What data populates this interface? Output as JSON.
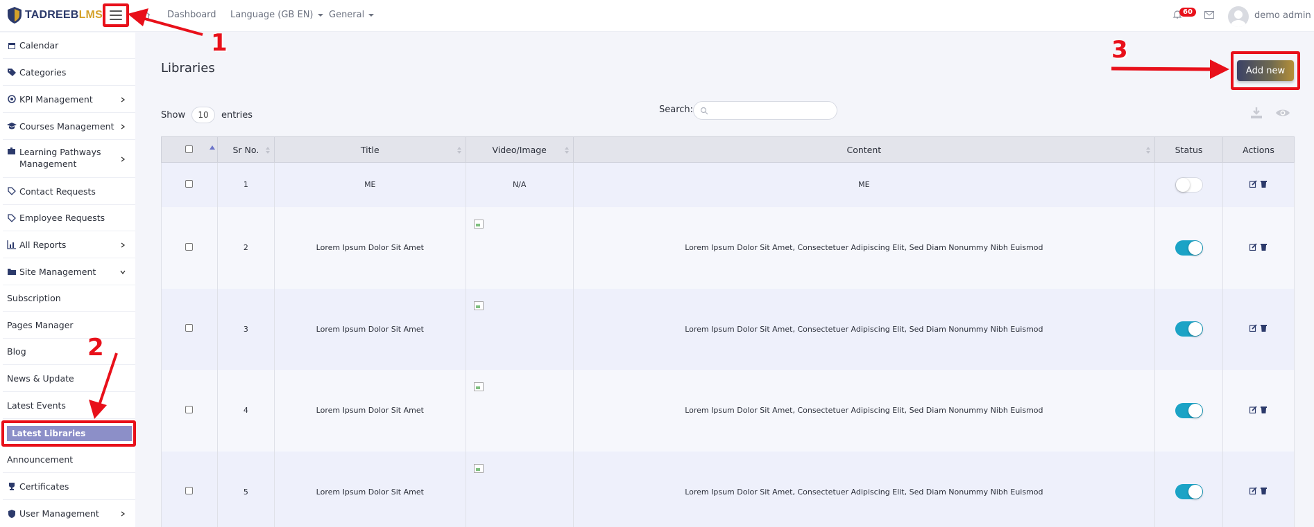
{
  "brand": {
    "name_main": "TADREEB",
    "name_accent": "LMS"
  },
  "topnav": {
    "dashboard": "Dashboard",
    "language": "Language (GB EN)",
    "general": "General",
    "notification_count": "60",
    "username": "demo admin"
  },
  "sidebar": {
    "items": [
      {
        "label": "Calendar",
        "icon": "calendar-icon"
      },
      {
        "label": "Categories",
        "icon": "tags-icon"
      },
      {
        "label": "KPI Management",
        "icon": "target-icon"
      },
      {
        "label": "Courses Management",
        "icon": "graduation-cap-icon"
      },
      {
        "label": "Learning Pathways Management",
        "icon": "puzzle-icon"
      },
      {
        "label": "Contact Requests",
        "icon": "tag-icon"
      },
      {
        "label": "Employee Requests",
        "icon": "tag-icon"
      },
      {
        "label": "All Reports",
        "icon": "chart-icon"
      },
      {
        "label": "Site Management",
        "icon": "folder-icon"
      },
      {
        "label": "Subscription"
      },
      {
        "label": "Pages Manager"
      },
      {
        "label": "Blog"
      },
      {
        "label": "News & Update"
      },
      {
        "label": "Latest Events"
      },
      {
        "label": "Latest Libraries"
      },
      {
        "label": "Announcement"
      },
      {
        "label": "Certificates",
        "icon": "trophy-icon"
      },
      {
        "label": "User Management",
        "icon": "shield-icon"
      }
    ]
  },
  "main": {
    "title": "Libraries",
    "add_new": "Add new",
    "show_label": "Show",
    "entries_value": "10",
    "entries_label": "entries",
    "search_label": "Search:"
  },
  "table": {
    "columns": [
      "Sr No.",
      "Title",
      "Video/Image",
      "Content",
      "Status",
      "Actions"
    ],
    "rows": [
      {
        "sr": "1",
        "title": "ME",
        "media": "N/A",
        "content": "ME",
        "status": "off"
      },
      {
        "sr": "2",
        "title": "Lorem Ipsum Dolor Sit Amet",
        "media": "image",
        "content": "Lorem Ipsum Dolor Sit Amet, Consectetuer Adipiscing Elit, Sed Diam Nonummy Nibh Euismod",
        "status": "on"
      },
      {
        "sr": "3",
        "title": "Lorem Ipsum Dolor Sit Amet",
        "media": "image",
        "content": "Lorem Ipsum Dolor Sit Amet, Consectetuer Adipiscing Elit, Sed Diam Nonummy Nibh Euismod",
        "status": "on"
      },
      {
        "sr": "4",
        "title": "Lorem Ipsum Dolor Sit Amet",
        "media": "image",
        "content": "Lorem Ipsum Dolor Sit Amet, Consectetuer Adipiscing Elit, Sed Diam Nonummy Nibh Euismod",
        "status": "on"
      },
      {
        "sr": "5",
        "title": "Lorem Ipsum Dolor Sit Amet",
        "media": "image",
        "content": "Lorem Ipsum Dolor Sit Amet, Consectetuer Adipiscing Elit, Sed Diam Nonummy Nibh Euismod",
        "status": "on"
      }
    ]
  },
  "annotations": {
    "one": "1",
    "two": "2",
    "three": "3"
  },
  "colors": {
    "annotation_red": "#e8101a",
    "toggle_on": "#1ba3c6",
    "active_sidebar": "#8c8fc8"
  }
}
